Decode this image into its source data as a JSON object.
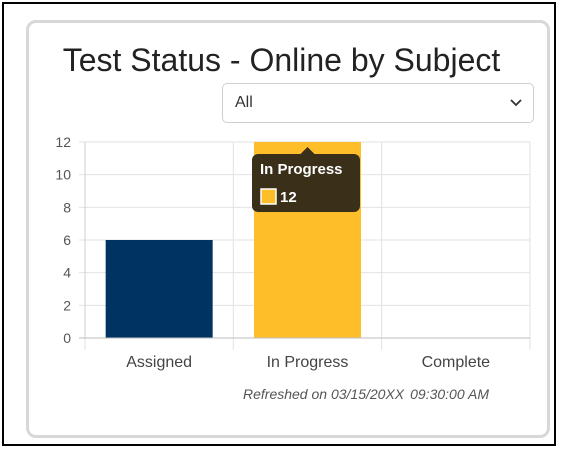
{
  "widget": {
    "title": "Test Status - Online by Subject",
    "filter": {
      "selected": "All"
    },
    "refreshed_label": "Refreshed on 03/15/20XX",
    "refreshed_time": "09:30:00 AM"
  },
  "chart_data": {
    "type": "bar",
    "categories": [
      "Assigned",
      "In Progress",
      "Complete"
    ],
    "values": [
      6,
      12,
      0
    ],
    "colors": [
      "#003361",
      "#fdbe2a",
      "#cccccc"
    ],
    "ylim": [
      0,
      12
    ],
    "yticks": [
      "0",
      "2",
      "4",
      "6",
      "8",
      "10",
      "12"
    ],
    "grid": true,
    "tooltip": {
      "title": "In Progress",
      "value": "12",
      "swatch_color": "#fdbe2a"
    }
  }
}
